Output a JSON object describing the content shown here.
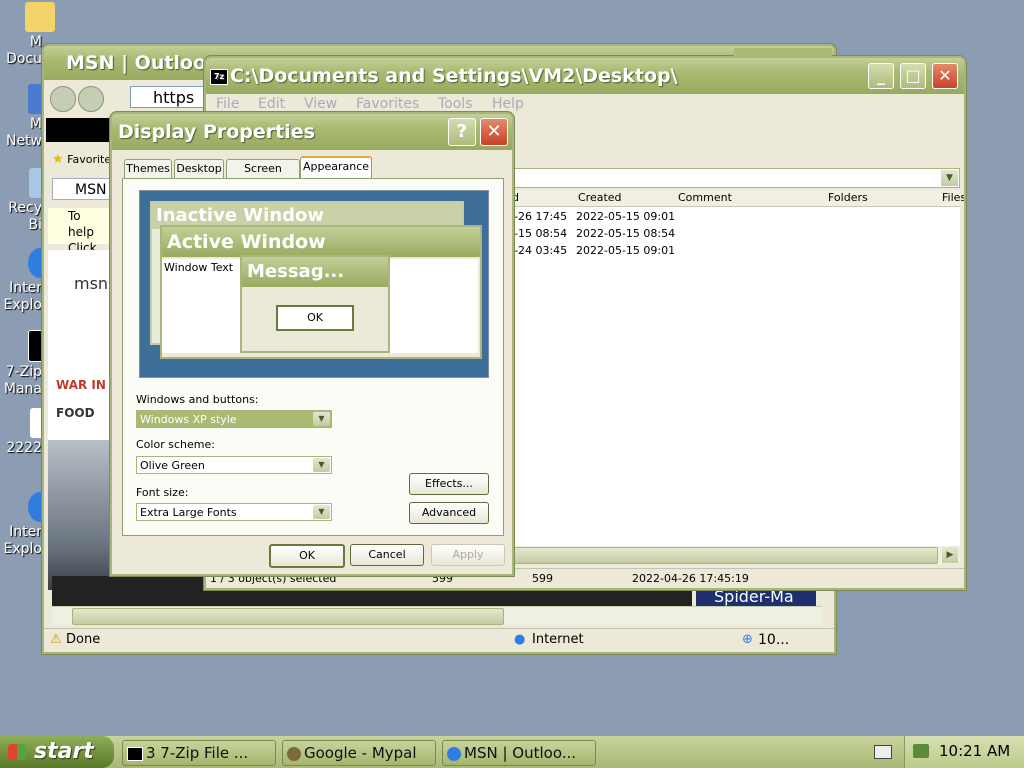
{
  "desktop": {
    "icons": [
      {
        "label": "M\nDocu"
      },
      {
        "label": "M\nNetw"
      },
      {
        "label": "Recy\nBi"
      },
      {
        "label": "Inter\nExplo"
      },
      {
        "label": "7-Zip\nMana"
      },
      {
        "label": "2222"
      },
      {
        "label": "Inter\nExplo"
      }
    ]
  },
  "ie_window": {
    "title": "MSN | Outloo",
    "address": "https",
    "favorites_label": "Favorite",
    "tab_label": "MSN",
    "help_text_1": "To help",
    "help_text_2": "Click he",
    "msn_logo": "msn",
    "war_label": "WAR IN",
    "food_label": "FOOD",
    "spider_text": "Spider-Ma",
    "status_done": "Done",
    "status_zone": "Internet",
    "zoom": "10..."
  },
  "explorer": {
    "title": "C:\\Documents and Settings\\VM2\\Desktop\\",
    "menu": [
      "File",
      "Edit",
      "View",
      "Favorites",
      "Tools",
      "Help"
    ],
    "columns": [
      "d",
      "Created",
      "Comment",
      "Folders",
      "Files"
    ],
    "rows": [
      {
        "modified": "-26 17:45",
        "created": "2022-05-15 09:01"
      },
      {
        "modified": "-15 08:54",
        "created": "2022-05-15 08:54"
      },
      {
        "modified": "-24 03:45",
        "created": "2022-05-15 09:01"
      }
    ],
    "status": {
      "selected": "1 / 3 object(s) selected",
      "size": "599",
      "packed": "599",
      "date": "2022-04-26 17:45:19"
    }
  },
  "display_props": {
    "title": "Display Properties",
    "tabs": [
      "Themes",
      "Desktop",
      "Screen Saver",
      "Appearance"
    ],
    "preview": {
      "inactive_title": "Inactive Window",
      "active_title": "Active Window",
      "window_text": "Window Text",
      "message_title": "Messag...",
      "ok": "OK"
    },
    "windows_buttons_label": "Windows and buttons:",
    "windows_buttons_value": "Windows XP style",
    "color_scheme_label": "Color scheme:",
    "color_scheme_value": "Olive Green",
    "font_size_label": "Font size:",
    "font_size_value": "Extra Large Fonts",
    "effects": "Effects...",
    "advanced": "Advanced",
    "ok": "OK",
    "cancel": "Cancel",
    "apply": "Apply"
  },
  "taskbar": {
    "start": "start",
    "buttons": [
      {
        "label": "3  7-Zip File ..."
      },
      {
        "label": "Google - Mypal"
      },
      {
        "label": "MSN | Outloo..."
      }
    ],
    "clock": "10:21 AM"
  },
  "colors": {
    "olive_title": "#a9ba72",
    "close_red": "#c8412a",
    "taskbar": "#b7c48a",
    "desktop": "#8c9cb2"
  }
}
